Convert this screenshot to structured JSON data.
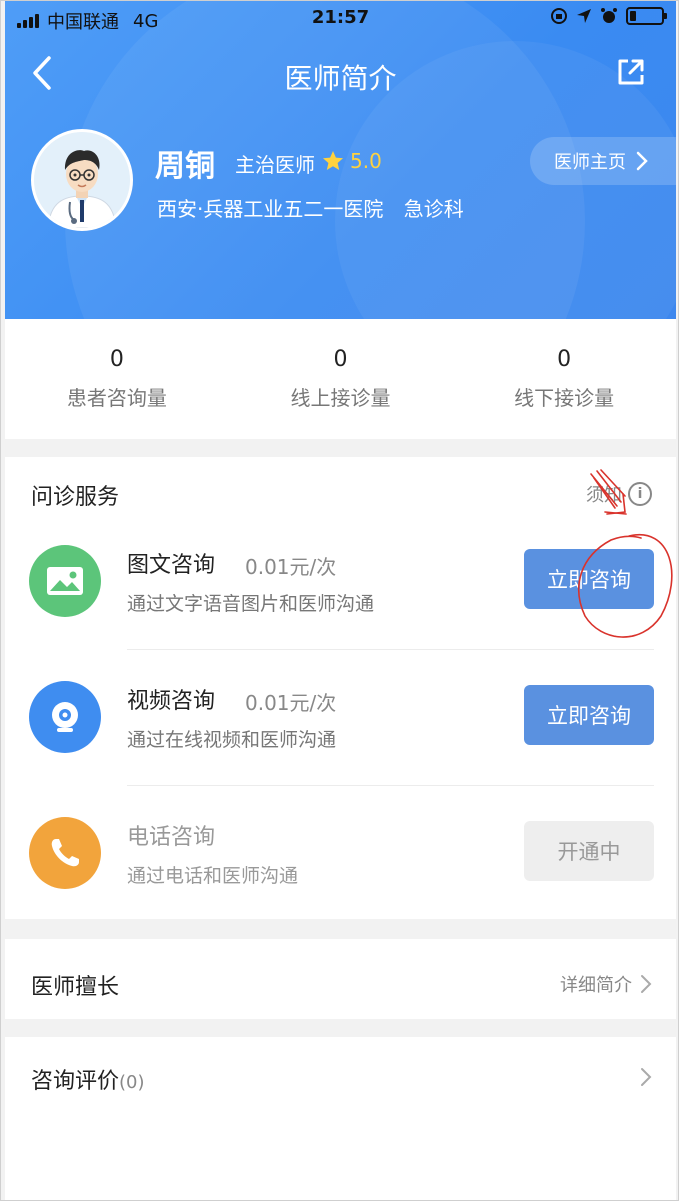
{
  "status_bar": {
    "carrier": "中国联通",
    "network": "4G",
    "time": "21:57"
  },
  "nav": {
    "title": "医师简介"
  },
  "doctor": {
    "name": "周铜",
    "title": "主治医师",
    "rating": "5.0",
    "hospital": "西安·兵器工业五二一医院",
    "department": "急诊科",
    "homepage_label": "医师主页"
  },
  "stats": [
    {
      "value": "0",
      "label": "患者咨询量"
    },
    {
      "value": "0",
      "label": "线上接诊量"
    },
    {
      "value": "0",
      "label": "线下接诊量"
    }
  ],
  "services": {
    "heading": "问诊服务",
    "notice_label": "须知",
    "items": [
      {
        "name": "图文咨询",
        "price": "0.01元/次",
        "desc": "通过文字语音图片和医师沟通",
        "button": "立即咨询",
        "icon": "image-icon",
        "color": "#5cc57a"
      },
      {
        "name": "视频咨询",
        "price": "0.01元/次",
        "desc": "通过在线视频和医师沟通",
        "button": "立即咨询",
        "icon": "camera-icon",
        "color": "#3f8df0"
      },
      {
        "name": "电话咨询",
        "price": "",
        "desc": "通过电话和医师沟通",
        "button": "开通中",
        "icon": "phone-icon",
        "color": "#f2a43c"
      }
    ]
  },
  "expertise": {
    "title": "医师擅长",
    "link": "详细简介"
  },
  "reviews": {
    "title": "咨询评价",
    "count": "(0)"
  },
  "colors": {
    "header_blue": "#4a97f5",
    "button_blue": "#5a91e0",
    "star_yellow": "#ffd23f",
    "annotation_red": "#d9332c"
  }
}
